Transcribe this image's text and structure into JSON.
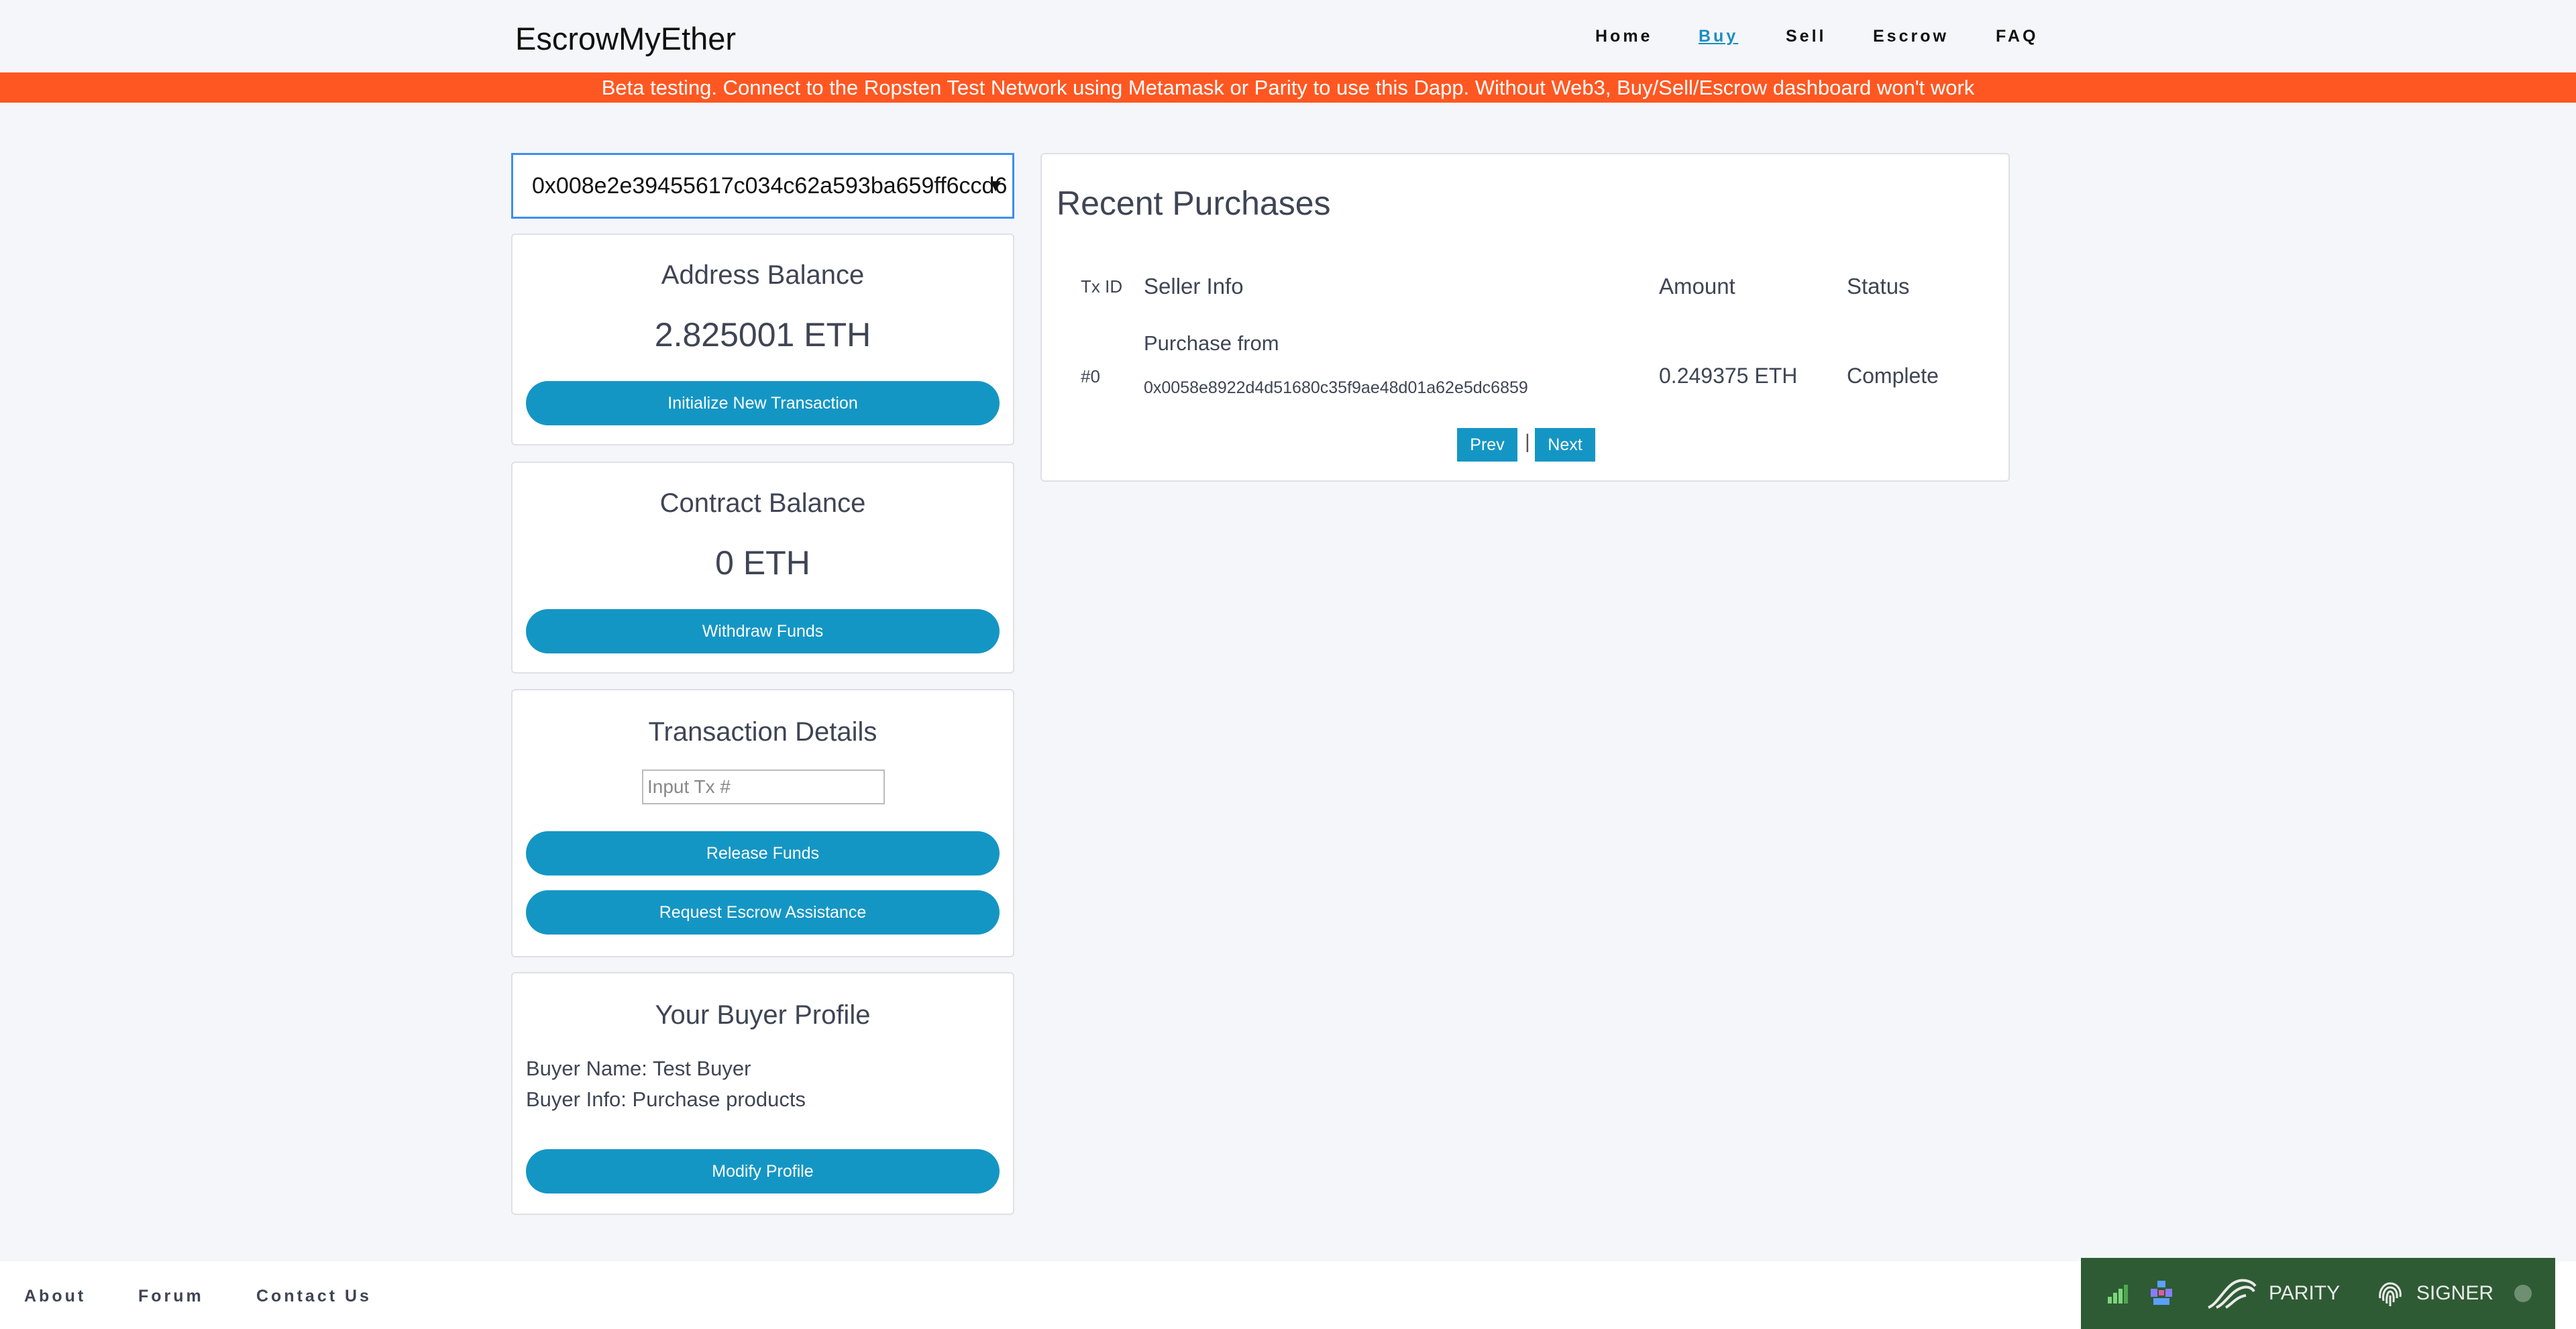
{
  "header": {
    "brand": "EscrowMyEther",
    "nav": [
      {
        "label": "Home"
      },
      {
        "label": "Buy",
        "active": true
      },
      {
        "label": "Sell"
      },
      {
        "label": "Escrow"
      },
      {
        "label": "FAQ"
      }
    ]
  },
  "banner": {
    "text": "Beta testing. Connect to the Ropsten Test Network using Metamask or Parity to use this Dapp. Without Web3, Buy/Sell/Escrow dashboard won't work"
  },
  "address_select": {
    "value": "0x008e2e39455617c034c62a593ba659ff6ccd6"
  },
  "address_balance": {
    "title": "Address Balance",
    "value": "2.825001 ETH",
    "button": "Initialize New Transaction"
  },
  "contract_balance": {
    "title": "Contract Balance",
    "value": "0 ETH",
    "button": "Withdraw Funds"
  },
  "transaction_details": {
    "title": "Transaction Details",
    "input_placeholder": "Input Tx #",
    "release_button": "Release Funds",
    "request_button": "Request Escrow Assistance"
  },
  "buyer_profile": {
    "title": "Your Buyer Profile",
    "name_line": "Buyer Name: Test Buyer",
    "info_line": "Buyer Info: Purchase products",
    "button": "Modify Profile"
  },
  "recent_purchases": {
    "title": "Recent Purchases",
    "columns": [
      "Tx ID",
      "Seller Info",
      "Amount",
      "Status"
    ],
    "rows": [
      {
        "tx_id": "#0",
        "seller_label": "Purchase from",
        "seller_address": "0x0058e8922d4d51680c35f9ae48d01a62e5dc6859",
        "amount": "0.249375 ETH",
        "status": "Complete"
      }
    ],
    "prev_label": "Prev",
    "separator": "|",
    "next_label": "Next"
  },
  "footer": {
    "links": [
      {
        "label": "About"
      },
      {
        "label": "Forum"
      },
      {
        "label": "Contact Us"
      }
    ]
  },
  "parity_bar": {
    "parity_label": "PARITY",
    "signer_label": "SIGNER",
    "bg_color": "#2e5b34"
  },
  "colors": {
    "accent": "#1496c4",
    "banner": "#ff5722",
    "background": "#f5f6f9"
  }
}
